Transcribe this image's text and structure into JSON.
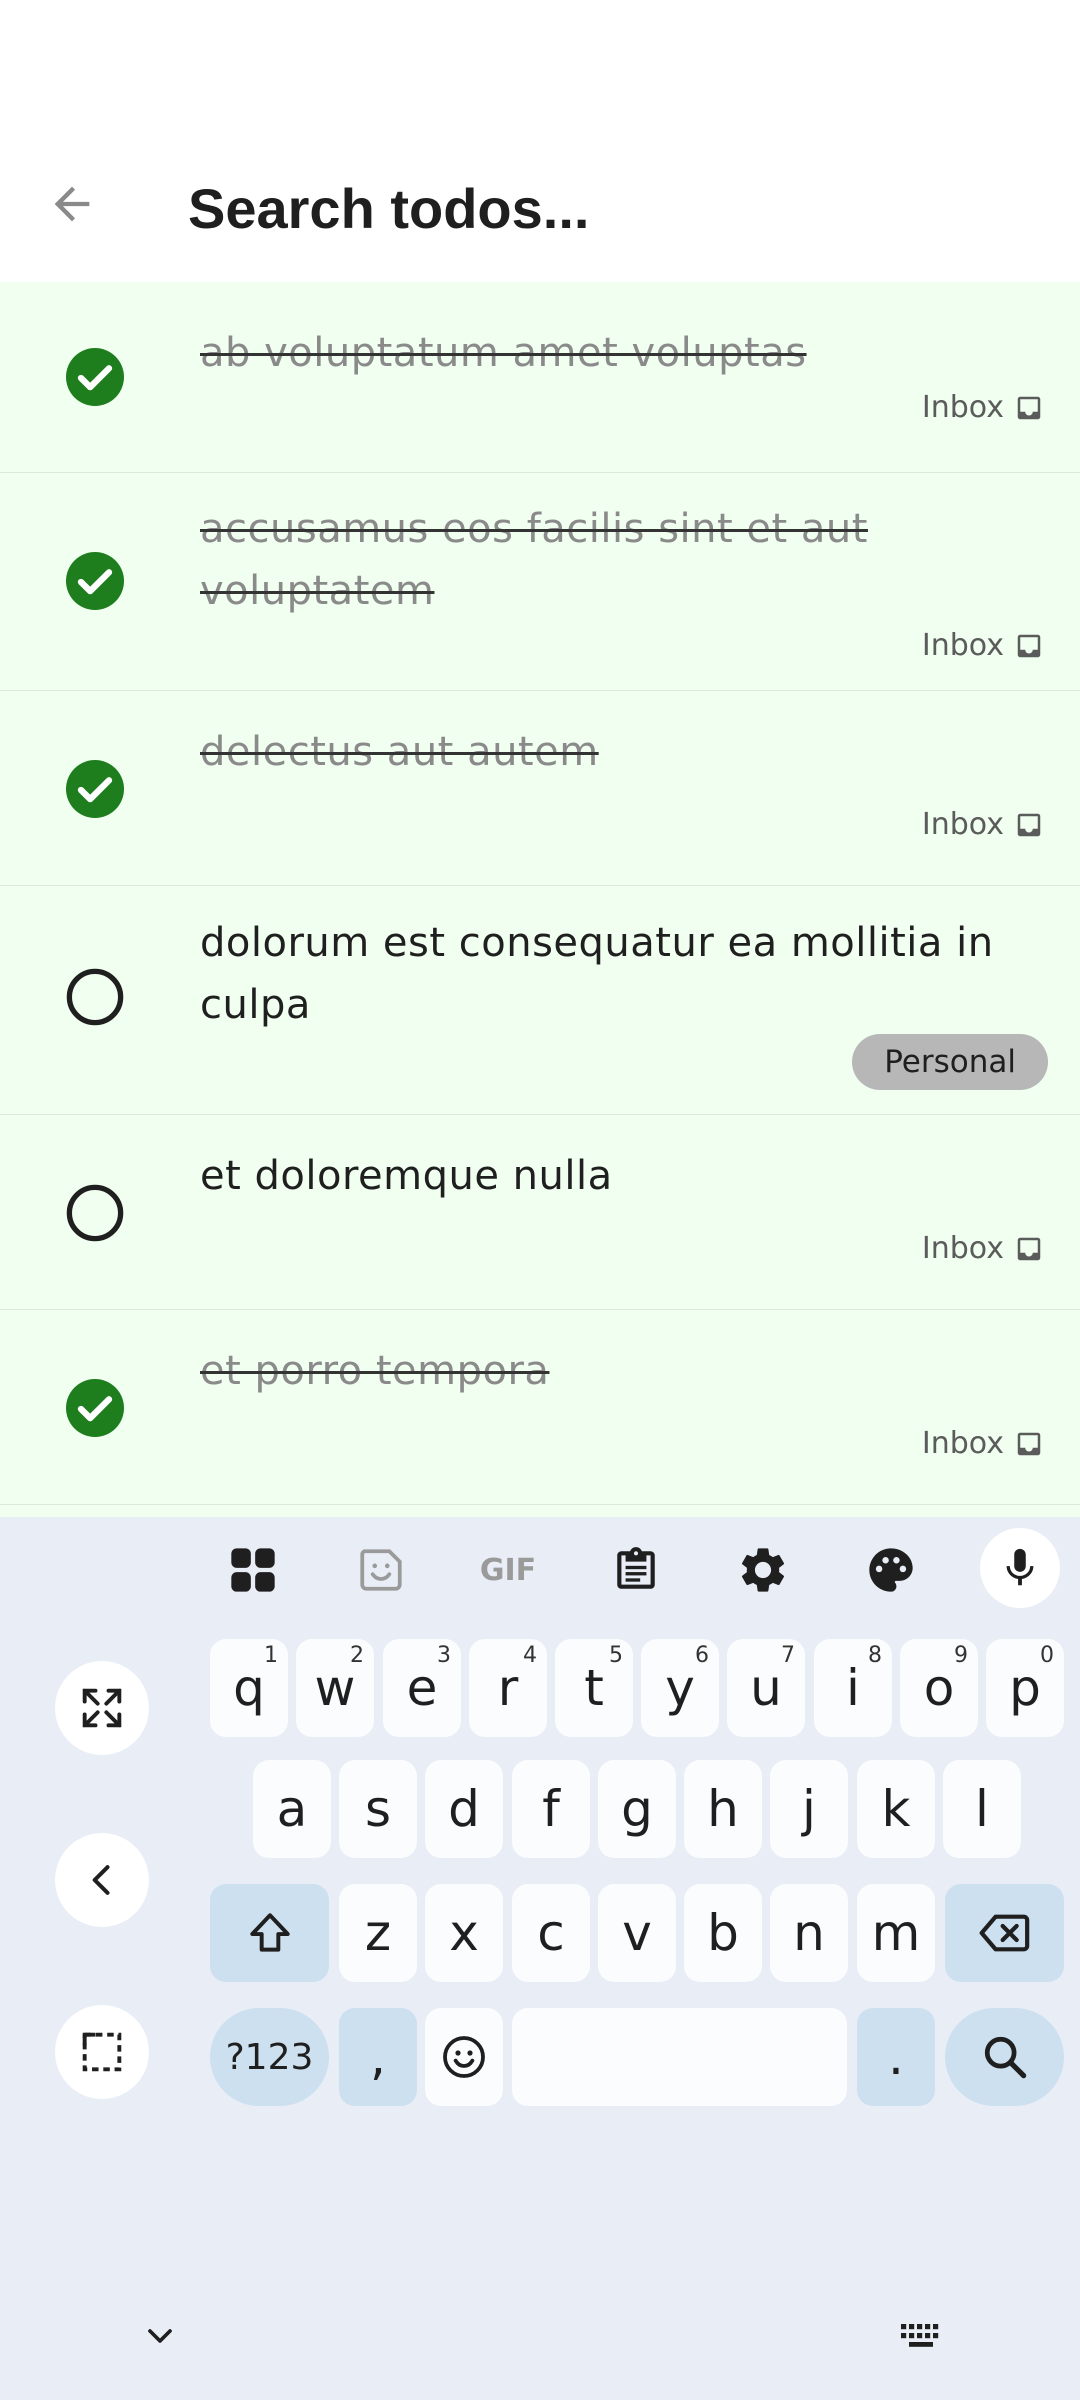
{
  "search": {
    "placeholder": "Search todos..."
  },
  "todos": [
    {
      "title": "ab voluptatum amet voluptas",
      "done": true,
      "tag": "Inbox"
    },
    {
      "title": "accusamus eos facilis sint et aut voluptatem",
      "done": true,
      "tag": "Inbox"
    },
    {
      "title": "delectus aut autem",
      "done": true,
      "tag": "Inbox"
    },
    {
      "title": "dolorum est consequatur ea mollitia in culpa",
      "done": false,
      "tag": "Personal"
    },
    {
      "title": "et doloremque nulla",
      "done": false,
      "tag": "Inbox"
    },
    {
      "title": "et porro tempora",
      "done": true,
      "tag": "Inbox"
    }
  ],
  "keyboard": {
    "row1": [
      "q",
      "w",
      "e",
      "r",
      "t",
      "y",
      "u",
      "i",
      "o",
      "p"
    ],
    "row1_hints": [
      "1",
      "2",
      "3",
      "4",
      "5",
      "6",
      "7",
      "8",
      "9",
      "0"
    ],
    "row2": [
      "a",
      "s",
      "d",
      "f",
      "g",
      "h",
      "j",
      "k",
      "l"
    ],
    "row3": [
      "z",
      "x",
      "c",
      "v",
      "b",
      "n",
      "m"
    ],
    "symbols_label": "?123",
    "comma_label": ",",
    "period_label": ".",
    "gif_label": "GIF"
  },
  "colors": {
    "done_check": "#1e7e1e",
    "list_bg": "#f0fff0",
    "keyboard_bg": "#e8edf6",
    "accent_key": "#cde0f0"
  }
}
